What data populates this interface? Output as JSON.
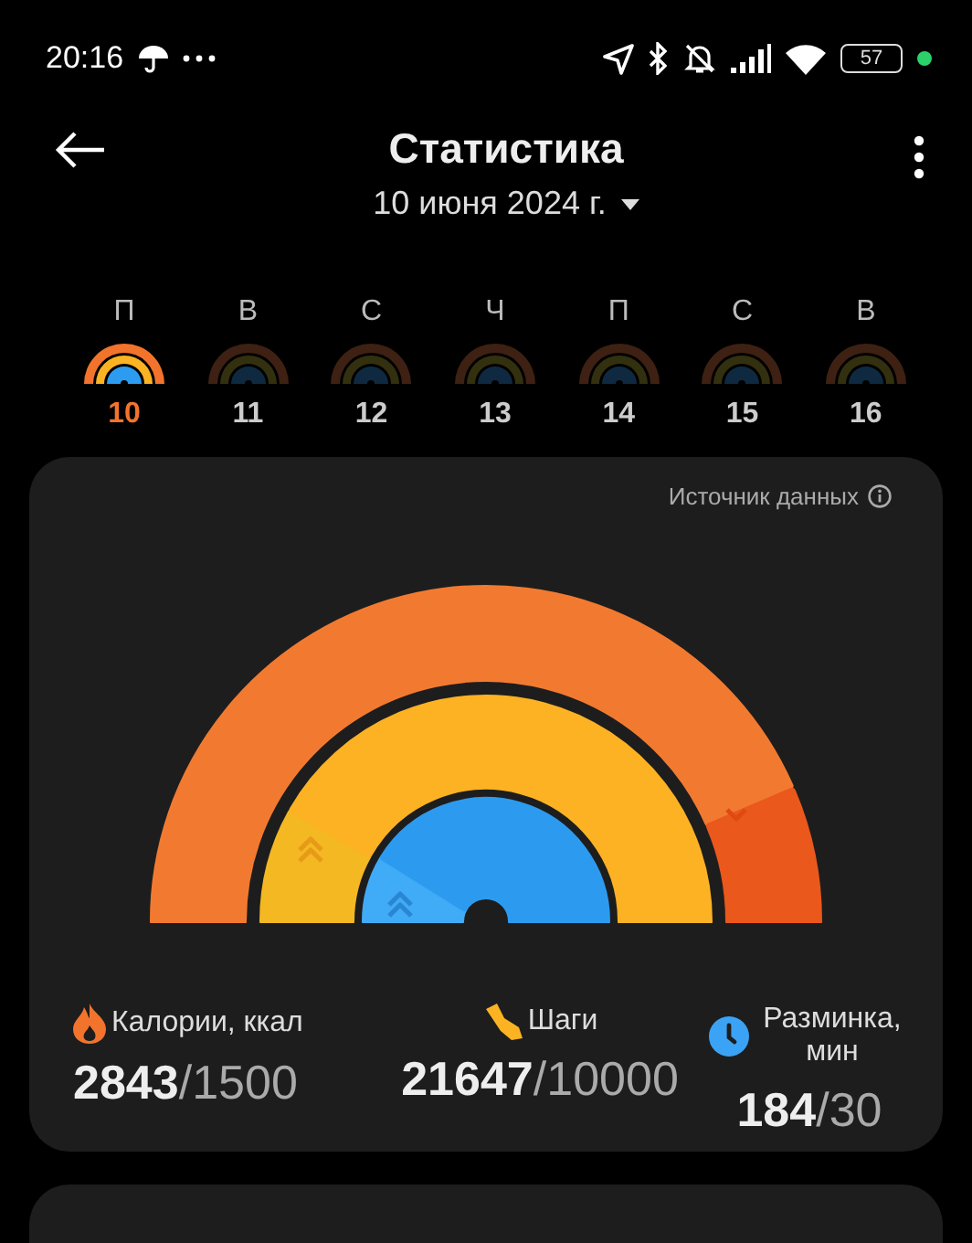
{
  "status_bar": {
    "time": "20:16",
    "battery": "57"
  },
  "header": {
    "title": "Статистика",
    "date": "10 июня 2024 г."
  },
  "week": [
    {
      "weekday": "П",
      "date": "10",
      "selected": true
    },
    {
      "weekday": "В",
      "date": "11",
      "selected": false
    },
    {
      "weekday": "С",
      "date": "12",
      "selected": false
    },
    {
      "weekday": "Ч",
      "date": "13",
      "selected": false
    },
    {
      "weekday": "П",
      "date": "14",
      "selected": false
    },
    {
      "weekday": "С",
      "date": "15",
      "selected": false
    },
    {
      "weekday": "В",
      "date": "16",
      "selected": false
    }
  ],
  "summary": {
    "source_link": "Источник данных",
    "metrics": [
      {
        "kind": "calories",
        "label": "Калории, ккал",
        "value": "2843",
        "goal": "/1500"
      },
      {
        "kind": "steps",
        "label": "Шаги",
        "value": "21647",
        "goal": "/10000"
      },
      {
        "kind": "workout",
        "label": "Разминка, мин",
        "value": "184",
        "goal": "/30"
      }
    ]
  }
}
